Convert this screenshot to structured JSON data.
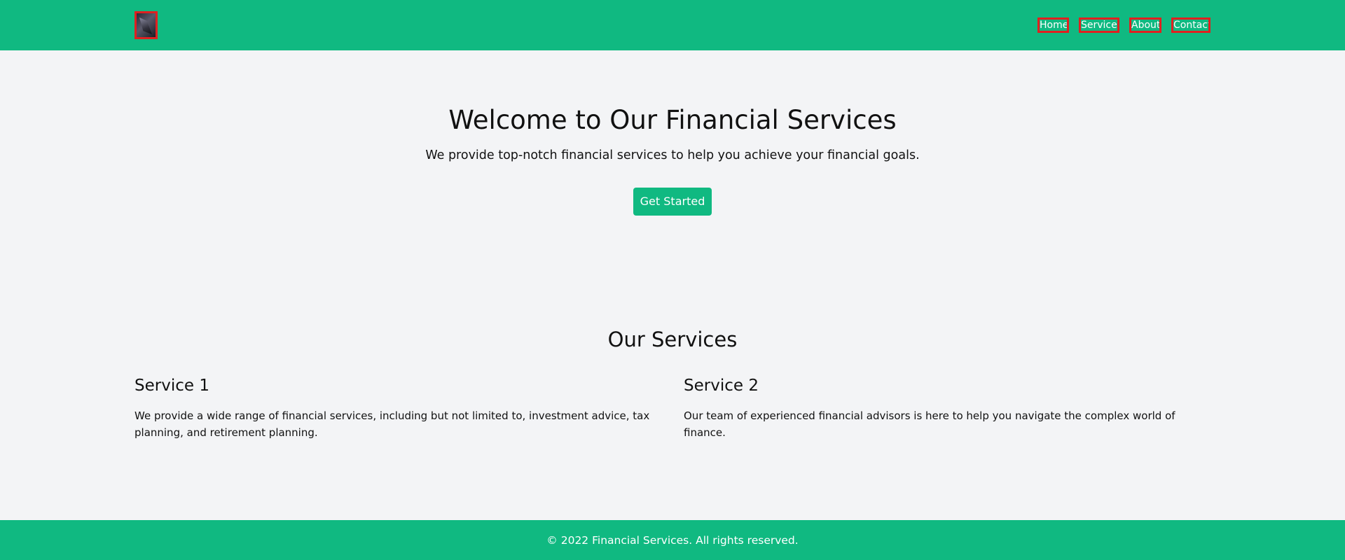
{
  "header": {
    "logo_alt": "logo",
    "nav": [
      {
        "label": "Home"
      },
      {
        "label": "Services"
      },
      {
        "label": "About"
      },
      {
        "label": "Contact"
      }
    ]
  },
  "hero": {
    "title": "Welcome to Our Financial Services",
    "subtitle": "We provide top-notch financial services to help you achieve your financial goals.",
    "cta_label": "Get Started"
  },
  "services": {
    "title": "Our Services",
    "items": [
      {
        "title": "Service 1",
        "description": "We provide a wide range of financial services, including but not limited to, investment advice, tax planning, and retirement planning."
      },
      {
        "title": "Service 2",
        "description": "Our team of experienced financial advisors is here to help you navigate the complex world of finance."
      }
    ]
  },
  "footer": {
    "text": "© 2022 Financial Services. All rights reserved."
  },
  "colors": {
    "brand": "#10b981",
    "background": "#f3f4f6",
    "highlight_border": "#e02020"
  }
}
